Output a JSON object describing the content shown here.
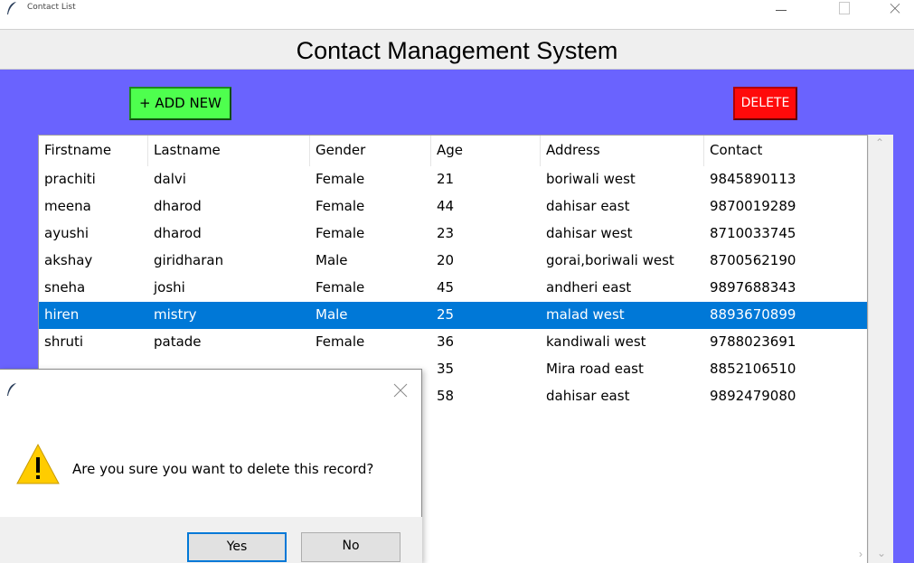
{
  "window": {
    "title": "Contact List"
  },
  "header": {
    "title": "Contact Management System"
  },
  "toolbar": {
    "add_label": "+ ADD NEW",
    "delete_label": "DELETE"
  },
  "table": {
    "columns": [
      "Firstname",
      "Lastname",
      "Gender",
      "Age",
      "Address",
      "Contact"
    ],
    "selected_row": 5,
    "rows": [
      [
        "prachiti",
        "dalvi",
        "Female",
        "21",
        "boriwali west",
        "9845890113"
      ],
      [
        "meena",
        "dharod",
        "Female",
        "44",
        "dahisar east",
        "9870019289"
      ],
      [
        "ayushi",
        "dharod",
        "Female",
        "23",
        "dahisar west",
        "8710033745"
      ],
      [
        "akshay",
        "giridharan",
        "Male",
        "20",
        "gorai,boriwali west",
        "8700562190"
      ],
      [
        "sneha",
        "joshi",
        "Female",
        "45",
        "andheri east",
        "9897688343"
      ],
      [
        "hiren",
        "mistry",
        "Male",
        "25",
        "malad west",
        "8893670899"
      ],
      [
        "shruti",
        "patade",
        "Female",
        "36",
        "kandiwali west",
        "9788023691"
      ],
      [
        "",
        "",
        "",
        "35",
        "Mira road east",
        "8852106510"
      ],
      [
        "",
        "",
        "",
        "58",
        "dahisar east",
        "9892479080"
      ]
    ]
  },
  "dialog": {
    "message": "Are you sure you want to delete this record?",
    "yes_label": "Yes",
    "no_label": "No"
  },
  "colors": {
    "background": "#6a63fe",
    "add_button": "#4eff4e",
    "delete_button": "#ff0a0a",
    "selection": "#0078d7"
  },
  "icons": [
    "feather-icon",
    "minimize-icon",
    "maximize-icon",
    "close-icon",
    "warning-icon"
  ]
}
